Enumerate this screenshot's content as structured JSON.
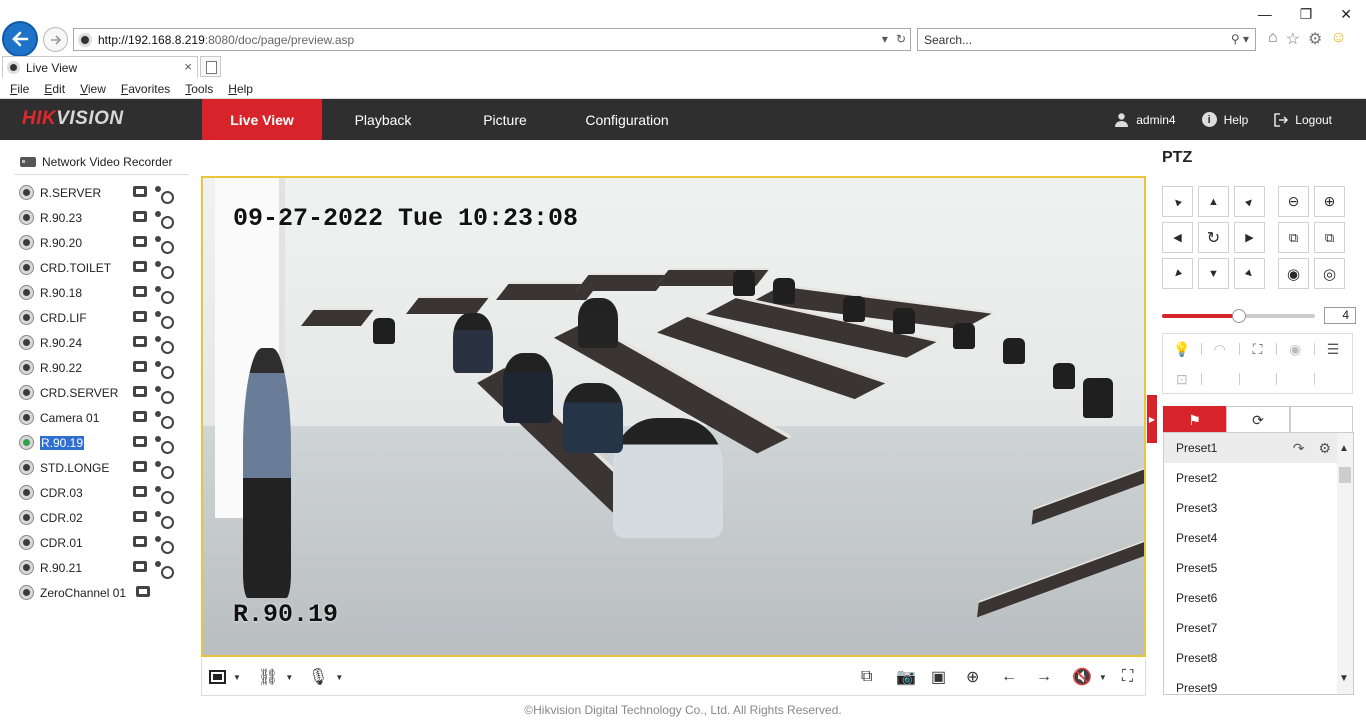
{
  "browser": {
    "url_host": "http://192.168.8.219",
    "url_rest": ":8080/doc/page/preview.asp",
    "search_placeholder": "Search...",
    "tab_title": "Live View",
    "menu": [
      "File",
      "Edit",
      "View",
      "Favorites",
      "Tools",
      "Help"
    ]
  },
  "app": {
    "logo_red": "HIK",
    "logo_gray": "VISION",
    "nav": [
      {
        "label": "Live View",
        "active": true
      },
      {
        "label": "Playback"
      },
      {
        "label": "Picture"
      },
      {
        "label": "Configuration"
      }
    ],
    "user": "admin4",
    "help": "Help",
    "logout": "Logout",
    "accent": "#d6242a"
  },
  "tree": {
    "root": "Network Video Recorder",
    "channels": [
      {
        "label": "R.SERVER"
      },
      {
        "label": "R.90.23"
      },
      {
        "label": "R.90.20"
      },
      {
        "label": "CRD.TOILET"
      },
      {
        "label": "R.90.18"
      },
      {
        "label": "CRD.LIF"
      },
      {
        "label": "R.90.24"
      },
      {
        "label": "R.90.22"
      },
      {
        "label": "CRD.SERVER"
      },
      {
        "label": "Camera 01"
      },
      {
        "label": "R.90.19",
        "selected": true,
        "live": true
      },
      {
        "label": "STD.LONGE"
      },
      {
        "label": "CDR.03"
      },
      {
        "label": "CDR.02"
      },
      {
        "label": "CDR.01"
      },
      {
        "label": "R.90.21"
      },
      {
        "label": "ZeroChannel 01",
        "zero": true
      }
    ]
  },
  "video": {
    "osd_time": "09-27-2022 Tue 10:23:08",
    "osd_name": "R.90.19"
  },
  "footer": "©Hikvision Digital Technology Co., Ltd. All Rights Reserved.",
  "ptz": {
    "title": "PTZ",
    "speed": "4",
    "speed_fraction": 0.5,
    "presets": [
      "Preset1",
      "Preset2",
      "Preset3",
      "Preset4",
      "Preset5",
      "Preset6",
      "Preset7",
      "Preset8",
      "Preset9"
    ]
  }
}
